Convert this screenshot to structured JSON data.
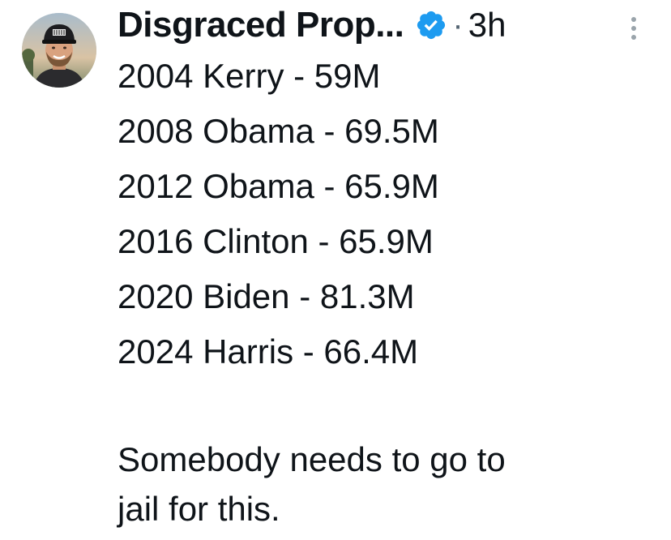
{
  "post": {
    "author": {
      "display_name": "Disgraced Prop...",
      "verified": true,
      "avatar": "profile-photo"
    },
    "dot": "·",
    "time": "3h",
    "more_icon": "vertical-ellipsis",
    "lines": [
      "2004 Kerry - 59M",
      "2008 Obama - 69.5M",
      "2012 Obama - 65.9M",
      "2016 Clinton - 65.9M",
      "2020 Biden - 81.3M",
      "2024 Harris - 66.4M"
    ],
    "closing_lines": [
      "Somebody needs to go to",
      "jail for this."
    ]
  },
  "colors": {
    "text": "#0f1419",
    "muted": "#536471",
    "verified_blue": "#1d9bf0",
    "background": "#ffffff"
  }
}
